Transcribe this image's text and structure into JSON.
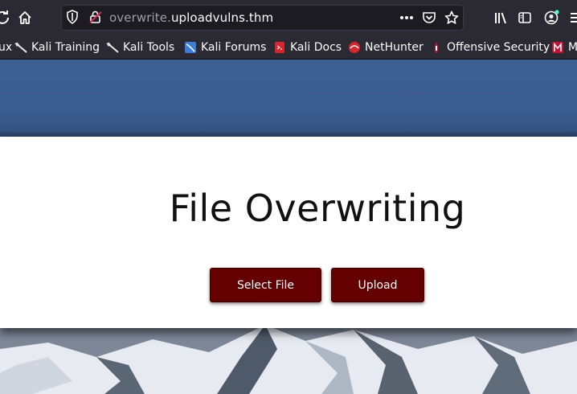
{
  "browser": {
    "url_subdomain": "overwrite.",
    "url_domain": "uploadvulns.thm",
    "bookmarks": [
      {
        "label": "ux",
        "icon": "firefox-icon"
      },
      {
        "label": "Kali Training",
        "icon": "kali-dragon-icon"
      },
      {
        "label": "Kali Tools",
        "icon": "kali-dragon-icon"
      },
      {
        "label": "Kali Forums",
        "icon": "kali-forums-icon"
      },
      {
        "label": "Kali Docs",
        "icon": "kali-docs-icon"
      },
      {
        "label": "NetHunter",
        "icon": "nethunter-icon"
      },
      {
        "label": "Offensive Security",
        "icon": "offsec-icon"
      },
      {
        "label": "M",
        "icon": "msfu-icon"
      }
    ]
  },
  "page": {
    "title": "File Overwriting",
    "select_button": "Select File",
    "upload_button": "Upload"
  },
  "colors": {
    "toolbar": "#2b2a33",
    "button": "#650000",
    "header": "#3c6193"
  }
}
